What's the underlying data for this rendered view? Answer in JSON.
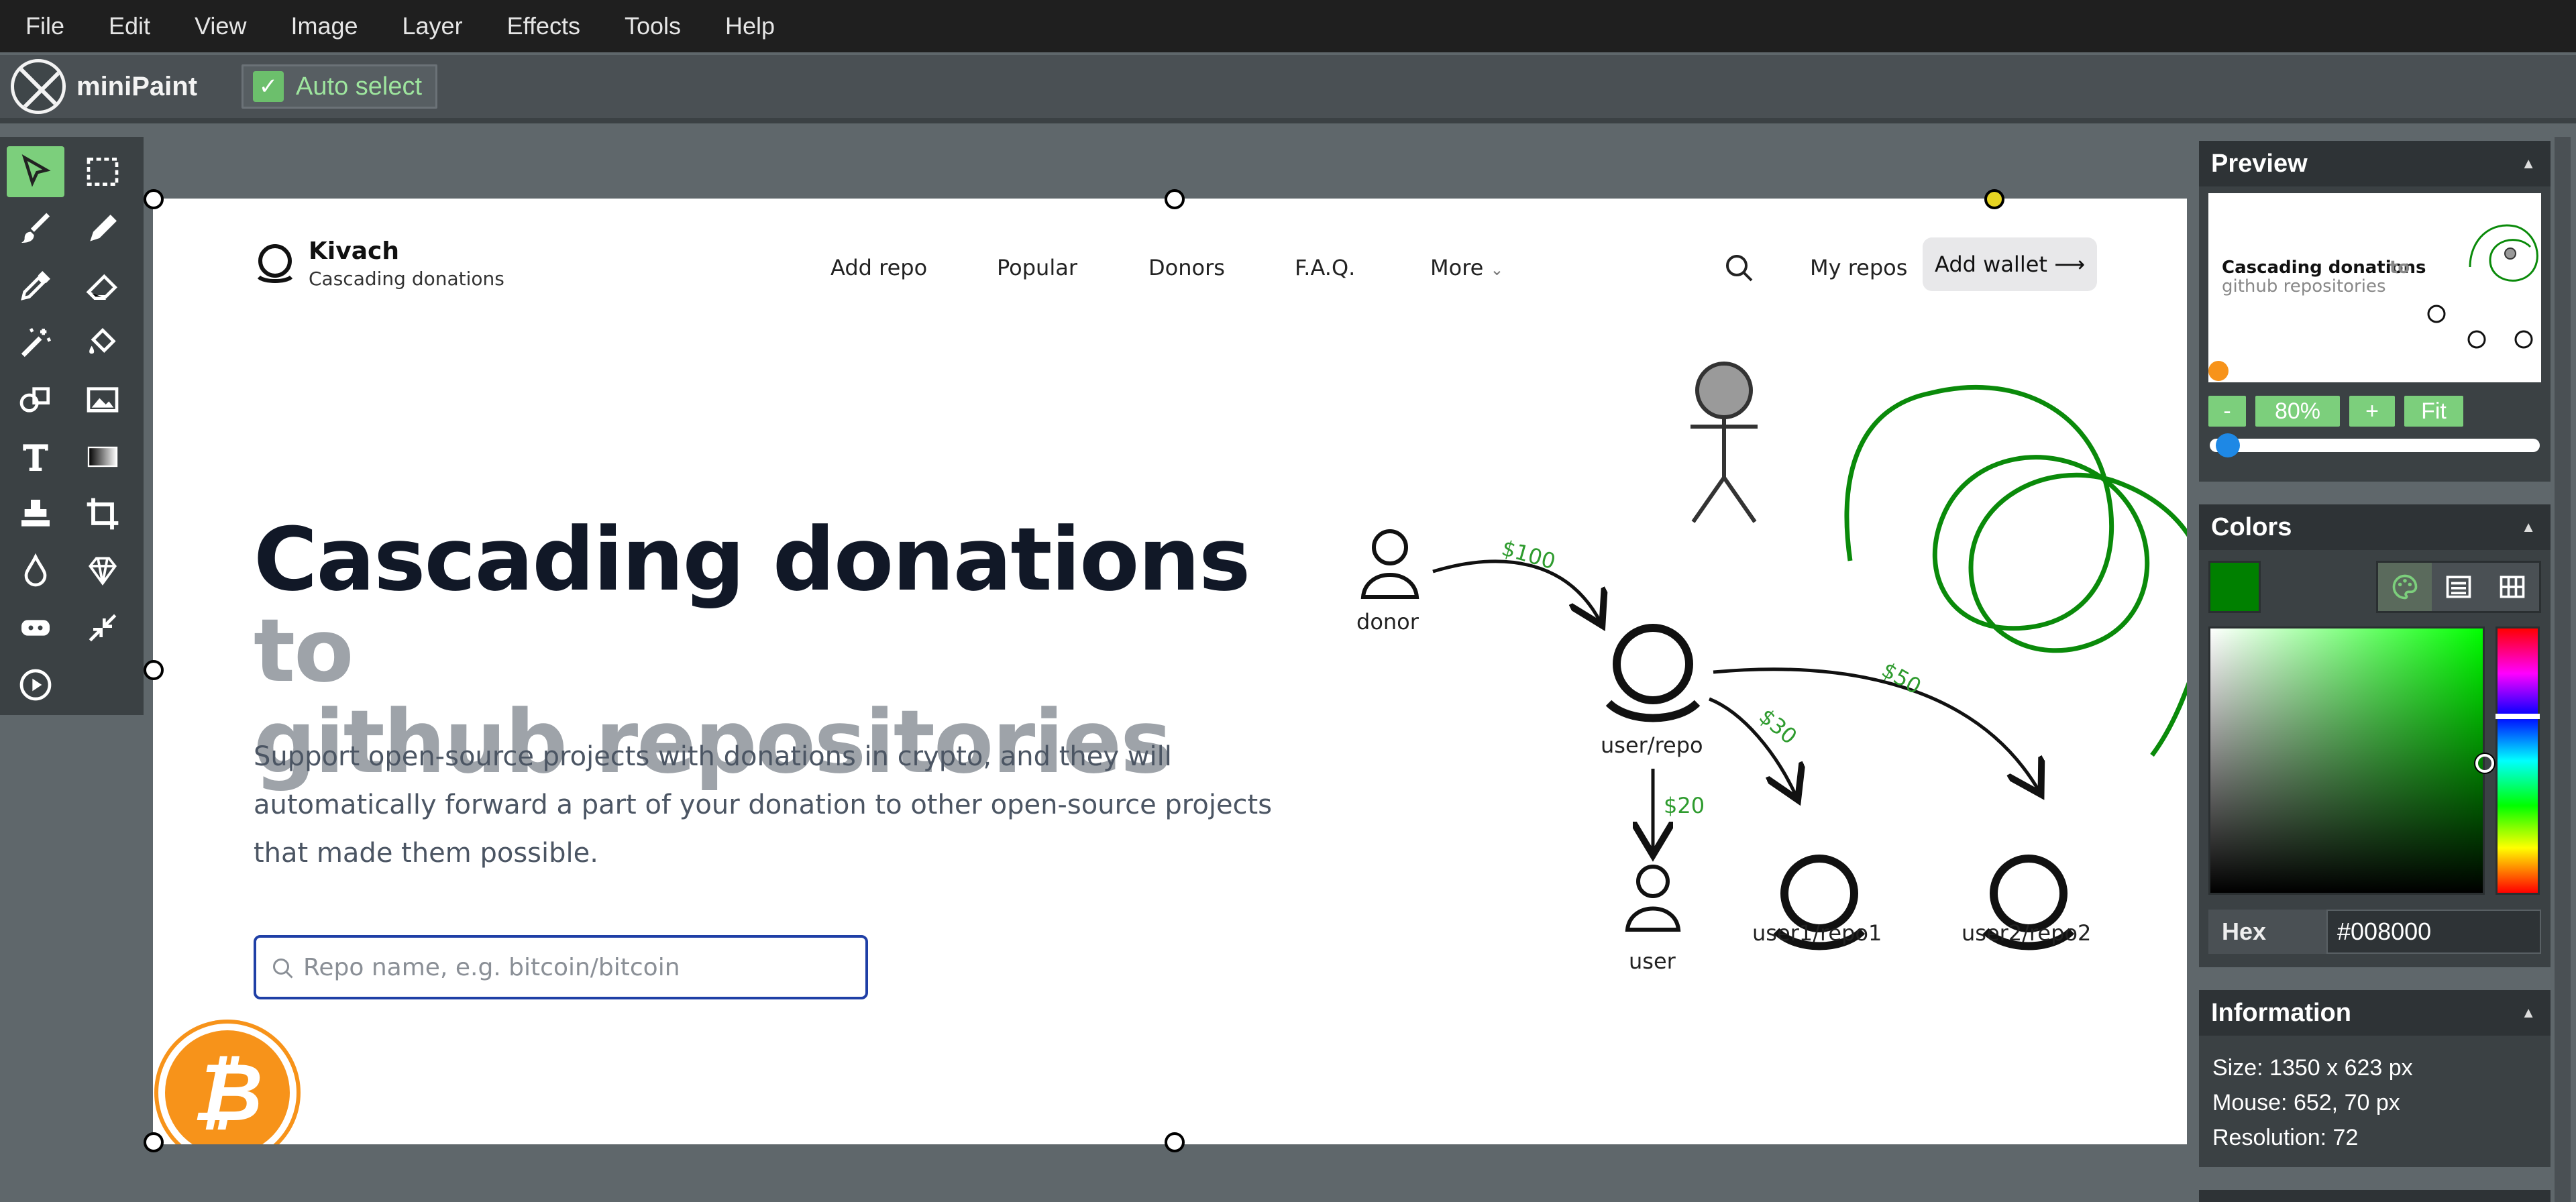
{
  "menu": [
    "File",
    "Edit",
    "View",
    "Image",
    "Layer",
    "Effects",
    "Tools",
    "Help"
  ],
  "app": {
    "name": "miniPaint"
  },
  "toolbar": {
    "auto_select_label": "Auto select",
    "auto_select_checked": true
  },
  "tools": [
    {
      "name": "select-icon",
      "active": true
    },
    {
      "name": "rect-select-icon"
    },
    {
      "name": "brush-icon"
    },
    {
      "name": "pencil-icon"
    },
    {
      "name": "pick-color-icon"
    },
    {
      "name": "erase-icon"
    },
    {
      "name": "magic-wand-icon"
    },
    {
      "name": "fill-icon"
    },
    {
      "name": "shape-icon"
    },
    {
      "name": "media-icon"
    },
    {
      "name": "text-icon"
    },
    {
      "name": "gradient-icon"
    },
    {
      "name": "clone-icon"
    },
    {
      "name": "crop-icon"
    },
    {
      "name": "blur-icon"
    },
    {
      "name": "sharpen-icon"
    },
    {
      "name": "desaturate-icon"
    },
    {
      "name": "bulge-pinch-icon"
    },
    {
      "name": "animation-icon"
    }
  ],
  "site": {
    "brand": "Kivach",
    "tagline": "Cascading donations",
    "nav": [
      "Add repo",
      "Popular",
      "Donors",
      "F.A.Q.",
      "More"
    ],
    "my_repos": "My repos",
    "add_wallet": "Add wallet ⟶",
    "headline_dark": "Cascading donations",
    "headline_grey_1": "to",
    "headline_grey_2": "github repositories",
    "description": "Support open-source projects with donations in crypto, and they will automatically forward a part of your donation to other open-source projects that made them possible.",
    "search_placeholder": "Repo name, e.g. bitcoin/bitcoin",
    "diagram": {
      "donor": "donor",
      "user_repo": "user/repo",
      "user": "user",
      "user1_repo1": "user1/repo1",
      "user2_repo2": "user2/repo2",
      "amt_100": "$100",
      "amt_50": "$50",
      "amt_30": "$30",
      "amt_20": "$20"
    }
  },
  "preview": {
    "title": "Preview",
    "zoom_minus": "-",
    "zoom": "80%",
    "zoom_plus": "+",
    "fit": "Fit",
    "zoom_slider_fraction": 0.02
  },
  "colors": {
    "title": "Colors",
    "hex_label": "Hex",
    "hex_value": "#008000",
    "current": "#008000"
  },
  "info": {
    "title": "Information",
    "size": "Size: 1350 x 623 px",
    "mouse": "Mouse: 652, 70 px",
    "resolution": "Resolution: 72"
  }
}
